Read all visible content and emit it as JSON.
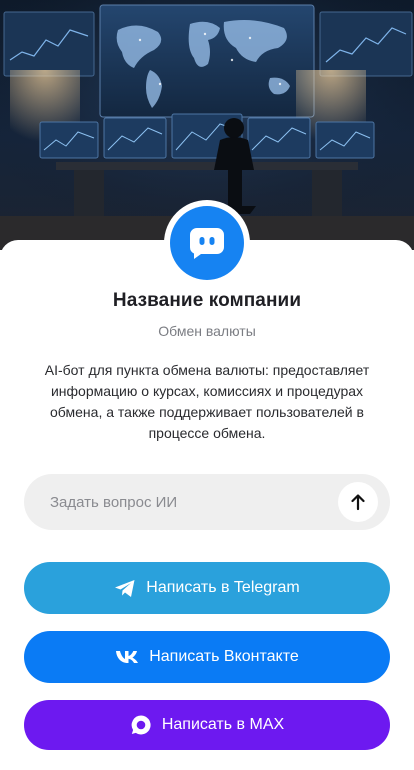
{
  "profile": {
    "name": "Название компании",
    "category": "Обмен валюты",
    "description": "AI-бот для пункта обмена валюты: предоставляет информацию о курсах, комиссиях и процедурах обмена, а также поддерживает пользователей в процессе обмена."
  },
  "ask": {
    "placeholder": "Задать вопрос ИИ"
  },
  "buttons": {
    "telegram": "Написать в Telegram",
    "vk": "Написать Вконтакте",
    "max": "Написать в MAX"
  },
  "colors": {
    "avatar": "#1683f2",
    "telegram": "#2aa1dc",
    "vk": "#0a7bf5",
    "max": "#6d19f0"
  },
  "icons": {
    "avatar": "chat-bot-icon",
    "send": "arrow-up-icon",
    "telegram": "telegram-icon",
    "vk": "vk-icon",
    "max": "max-icon"
  }
}
